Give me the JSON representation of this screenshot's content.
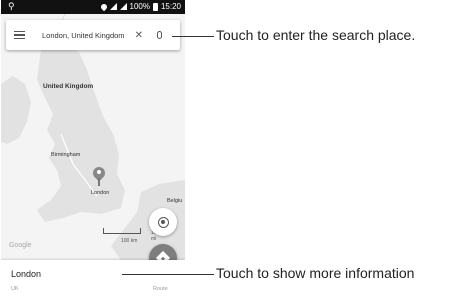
{
  "status_bar": {
    "usb_symbol": "⚲",
    "battery": "100%",
    "time": "15:20"
  },
  "search": {
    "value": "London, United Kingdom",
    "clear_symbol": "✕"
  },
  "map": {
    "labels": {
      "uk": "United Kingdom",
      "birmingham": "Birmingham",
      "london": "London",
      "belgium": "Belgiu",
      "google": "Google"
    },
    "scale": {
      "top": "100 mi",
      "bottom": "100 km"
    }
  },
  "place": {
    "title": "London",
    "subtitle": "UK",
    "route": "Route"
  },
  "callouts": {
    "search": "Touch to enter the search place.",
    "info": "Touch to show more information"
  },
  "colors": {
    "status_bar": "#111111",
    "land": "#e2e2e2",
    "water": "#f4f4f4",
    "fab": "#7e7e7e"
  },
  "icons": [
    "usb-icon",
    "location-icon",
    "signal-icon",
    "battery-icon",
    "menu-icon",
    "clear-icon",
    "mic-icon",
    "map-marker-icon",
    "my-location-icon",
    "directions-icon"
  ]
}
